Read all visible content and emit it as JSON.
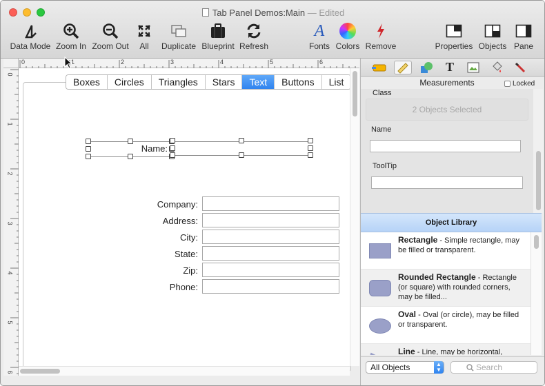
{
  "window": {
    "title": "Tab Panel Demos:Main",
    "edited": "— Edited"
  },
  "toolbar": {
    "items": [
      {
        "label": "Data Mode",
        "icon": "data-mode-icon"
      },
      {
        "label": "Zoom In",
        "icon": "zoom-in-icon"
      },
      {
        "label": "Zoom Out",
        "icon": "zoom-out-icon"
      },
      {
        "label": "All",
        "icon": "expand-all-icon"
      },
      {
        "label": "Duplicate",
        "icon": "duplicate-icon"
      },
      {
        "label": "Blueprint",
        "icon": "blueprint-icon"
      },
      {
        "label": "Refresh",
        "icon": "refresh-icon"
      },
      {
        "label": "Fonts",
        "icon": "fonts-icon"
      },
      {
        "label": "Colors",
        "icon": "colors-icon"
      },
      {
        "label": "Remove",
        "icon": "remove-icon"
      },
      {
        "label": "Properties",
        "icon": "properties-icon"
      },
      {
        "label": "Objects",
        "icon": "objects-icon"
      },
      {
        "label": "Pane",
        "icon": "pane-icon"
      }
    ]
  },
  "ruler": {
    "h_labels": [
      "0",
      "1",
      "2",
      "3",
      "4",
      "5",
      "6"
    ],
    "v_labels": [
      "0",
      "1",
      "2",
      "3",
      "4",
      "5",
      "6"
    ]
  },
  "tabs": [
    "Boxes",
    "Circles",
    "Triangles",
    "Stars",
    "Text",
    "Buttons",
    "List"
  ],
  "selected_tab": "Text",
  "form": {
    "name_label": "Name:",
    "fields": [
      {
        "label": "Company:",
        "value": ""
      },
      {
        "label": "Address:",
        "value": ""
      },
      {
        "label": "City:",
        "value": ""
      },
      {
        "label": "State:",
        "value": ""
      },
      {
        "label": "Zip:",
        "value": ""
      },
      {
        "label": "Phone:",
        "value": ""
      }
    ]
  },
  "inspector": {
    "title": "Measurements",
    "locked_label": "Locked",
    "class_label": "Class",
    "class_value": "2 Objects Selected",
    "name_label": "Name",
    "name_value": "",
    "tooltip_label": "ToolTip",
    "tooltip_value": ""
  },
  "library": {
    "title": "Object Library",
    "items": [
      {
        "name": "Rectangle",
        "desc": " - Simple rectangle, may be filled or transparent."
      },
      {
        "name": "Rounded Rectangle",
        "desc": " - Rectangle (or square) with rounded corners, may be filled..."
      },
      {
        "name": "Oval",
        "desc": " - Oval (or circle), may be filled or transparent."
      },
      {
        "name": "Line",
        "desc": " - Line, may be horizontal,"
      }
    ],
    "filter_value": "All Objects",
    "search_placeholder": "Search"
  },
  "colors": {
    "accent": "#2f83ef",
    "close": "#fc5f57",
    "minimize": "#fdbc2e",
    "zoom": "#2ac840",
    "remove": "#d0262b"
  }
}
